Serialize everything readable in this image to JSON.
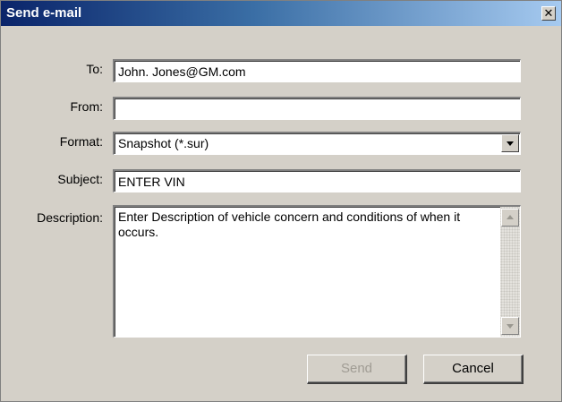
{
  "window": {
    "title": "Send e-mail",
    "close_glyph": "✕"
  },
  "form": {
    "to": {
      "label": "To:",
      "value": "John. Jones@GM.com"
    },
    "from": {
      "label": "From:",
      "value": ""
    },
    "format": {
      "label": "Format:",
      "value": "Snapshot (*.sur)"
    },
    "subject": {
      "label": "Subject:",
      "value": "ENTER VIN"
    },
    "description": {
      "label": "Description:",
      "value": "Enter Description of vehicle concern and conditions of when it occurs."
    }
  },
  "buttons": {
    "send": {
      "label": "Send",
      "enabled": false
    },
    "cancel": {
      "label": "Cancel",
      "enabled": true
    }
  },
  "icons": {
    "close": "close-icon",
    "dropdown": "chevron-down-icon",
    "scroll_up": "scroll-up-arrow-icon",
    "scroll_down": "scroll-down-arrow-icon"
  },
  "colors": {
    "titlebar_start": "#0a246a",
    "titlebar_end": "#a6caf0",
    "dialog_bg": "#d4d0c8",
    "disabled_text": "#a09c94"
  }
}
